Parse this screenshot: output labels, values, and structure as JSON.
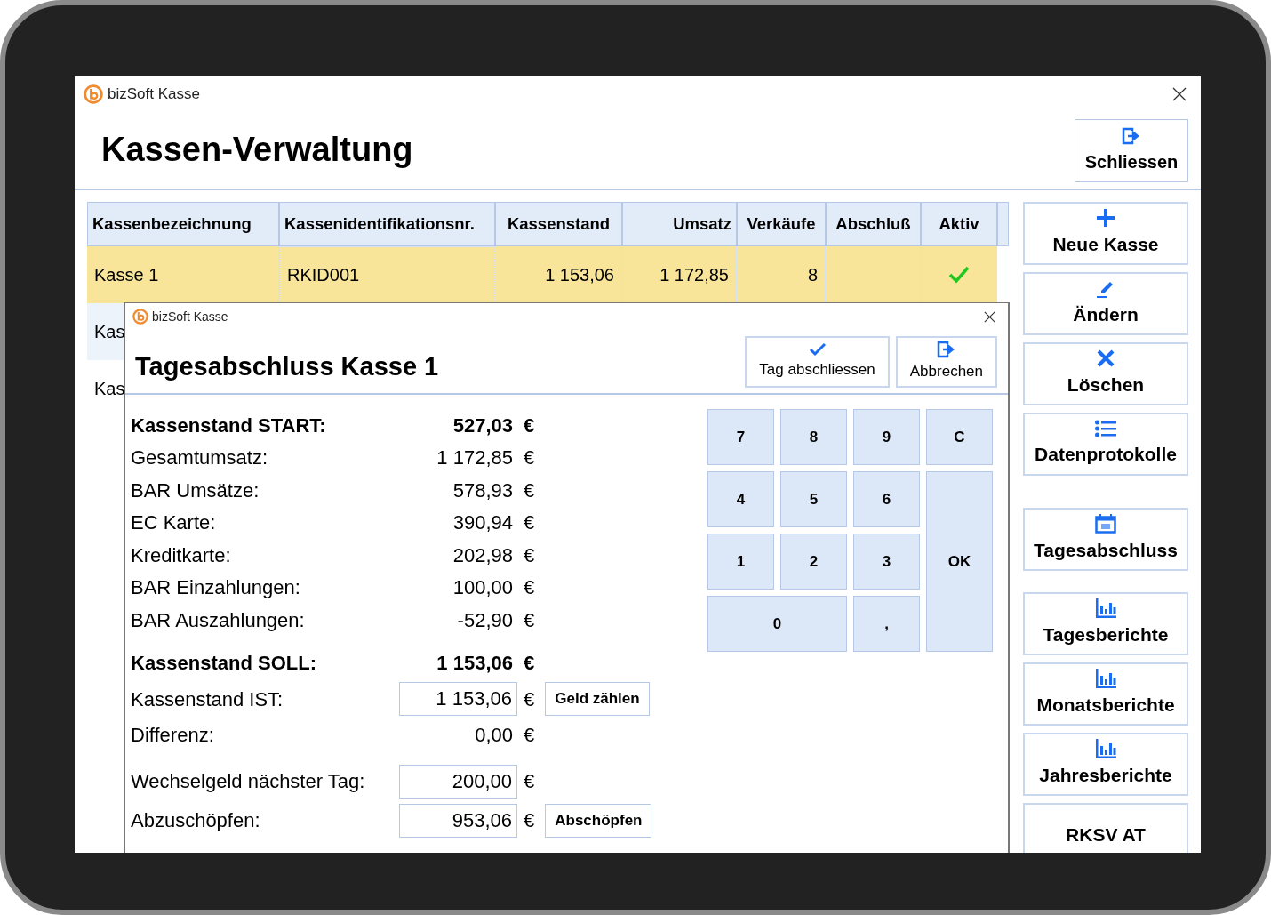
{
  "window": {
    "title": "bizSoft Kasse",
    "page_title": "Kassen-Verwaltung",
    "header_button": {
      "label": "Schliessen",
      "kind": "exit"
    }
  },
  "table": {
    "columns": [
      {
        "label": "Kassenbezeichnung"
      },
      {
        "label": "Kassenidentifikationsnr."
      },
      {
        "label": "Kassenstand"
      },
      {
        "label": "Umsatz"
      },
      {
        "label": "Verkäufe"
      },
      {
        "label": "Abschluß"
      },
      {
        "label": "Aktiv"
      }
    ],
    "rows": [
      {
        "cells": [
          "Kasse 1",
          "RKID001",
          "1 153,06",
          "1 172,85",
          "8",
          ""
        ],
        "active": true,
        "selected": true
      },
      {
        "cells": [
          "Kas"
        ],
        "selected": false
      },
      {
        "cells": [
          "Kas"
        ],
        "selected": false
      }
    ]
  },
  "side_button_groups": [
    [
      {
        "label": "Neue Kasse",
        "kind": "plus"
      },
      {
        "label": "Ändern",
        "kind": "pencil"
      },
      {
        "label": "Löschen",
        "kind": "cross"
      },
      {
        "label": "Datenprotokolle",
        "kind": "list"
      }
    ],
    [
      {
        "label": "Tagesabschluss",
        "kind": "calendar"
      }
    ],
    [
      {
        "label": "Tagesberichte",
        "kind": "chart"
      },
      {
        "label": "Monatsberichte",
        "kind": "chart"
      },
      {
        "label": "Jahresberichte",
        "kind": "chart"
      },
      {
        "label": "RKSV AT",
        "kind": "text"
      }
    ]
  ],
  "dialog": {
    "title": "bizSoft Kasse",
    "heading": "Tagesabschluss Kasse 1",
    "buttons": [
      {
        "label": "Tag abschliessen",
        "kind": "check"
      },
      {
        "label": "Abbrechen",
        "kind": "exit"
      }
    ],
    "row_groups": [
      [
        {
          "label": "Kassenstand START:",
          "value": "527,03",
          "currency": "€",
          "kind": "total"
        },
        {
          "label": "Gesamtumsatz:",
          "value": "1 172,85",
          "currency": "€",
          "kind": "plain"
        },
        {
          "label": "BAR Umsätze:",
          "value": "578,93",
          "currency": "€",
          "kind": "plain"
        },
        {
          "label": "EC Karte:",
          "value": "390,94",
          "currency": "€",
          "kind": "plain"
        },
        {
          "label": "Kreditkarte:",
          "value": "202,98",
          "currency": "€",
          "kind": "plain"
        },
        {
          "label": "BAR Einzahlungen:",
          "value": "100,00",
          "currency": "€",
          "kind": "plain"
        },
        {
          "label": "BAR Auszahlungen:",
          "value": "-52,90",
          "currency": "€",
          "kind": "plain"
        }
      ],
      [
        {
          "label": "Kassenstand SOLL:",
          "value": "1 153,06",
          "currency": "€",
          "kind": "total"
        },
        {
          "label": "Kassenstand IST:",
          "value": "1 153,06",
          "currency": "€",
          "kind": "field",
          "button": "Geld zählen"
        },
        {
          "label": "Differenz:",
          "value": "0,00",
          "currency": "€",
          "kind": "plain"
        }
      ],
      [
        {
          "label": "Wechselgeld nächster Tag:",
          "value": "200,00",
          "currency": "€",
          "kind": "field"
        },
        {
          "label": "Abzuschöpfen:",
          "value": "953,06",
          "currency": "€",
          "kind": "field",
          "button": "Abschöpfen"
        }
      ]
    ],
    "keypad": [
      {
        "label": "7",
        "kind": "key"
      },
      {
        "label": "8",
        "kind": "key"
      },
      {
        "label": "9",
        "kind": "key"
      },
      {
        "label": "C",
        "kind": "key"
      },
      {
        "label": "4",
        "kind": "key"
      },
      {
        "label": "5",
        "kind": "key"
      },
      {
        "label": "6",
        "kind": "key"
      },
      {
        "label": "1",
        "kind": "key"
      },
      {
        "label": "2",
        "kind": "key"
      },
      {
        "label": "3",
        "kind": "key"
      },
      {
        "label": "OK",
        "kind": "tall"
      },
      {
        "label": "0",
        "kind": "wide"
      },
      {
        "label": ",",
        "kind": "key"
      }
    ]
  }
}
